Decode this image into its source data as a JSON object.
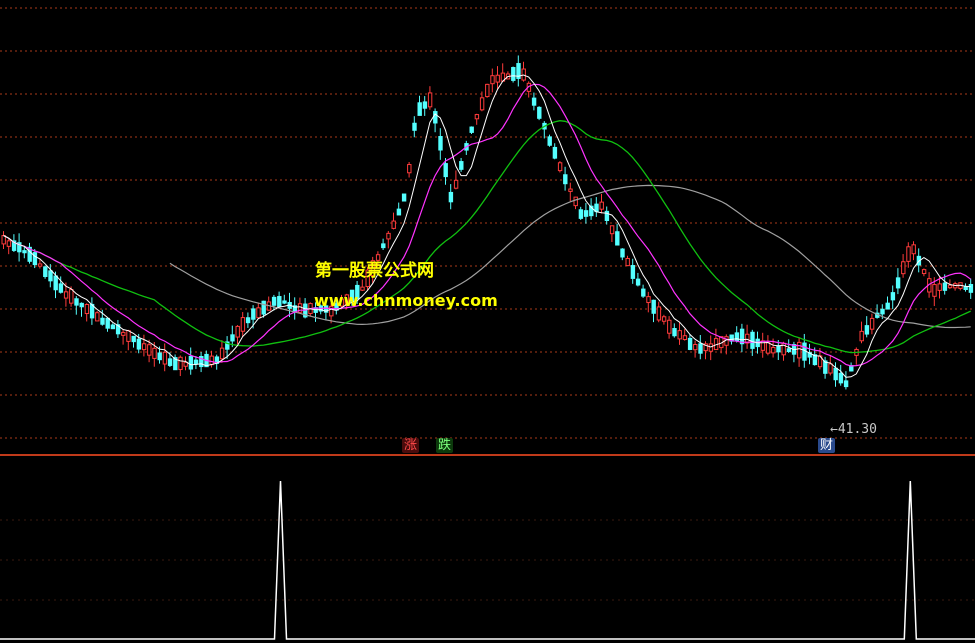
{
  "watermark": {
    "title": "第一股票公式网",
    "url": "www.chnmoney.com"
  },
  "markers": {
    "up": "涨",
    "down": "跌",
    "finance": "财"
  },
  "low_price": {
    "label": "←41.30",
    "value": 41.3
  },
  "colors": {
    "background": "#000000",
    "grid": "#a83a1a",
    "panel_divider": "#c03a1a",
    "candle_up": "#ff3b3b",
    "candle_down": "#54ffff",
    "ma_short": "#ffffff",
    "ma_mid": "#ff33ff",
    "ma_long": "#10c010",
    "ma_longest": "#a0a0a0",
    "indicator": "#ffffff"
  },
  "indicator_signals": [
    {
      "bar_index": 20,
      "value": 1
    },
    {
      "bar_index": 154,
      "value": 1
    }
  ]
}
